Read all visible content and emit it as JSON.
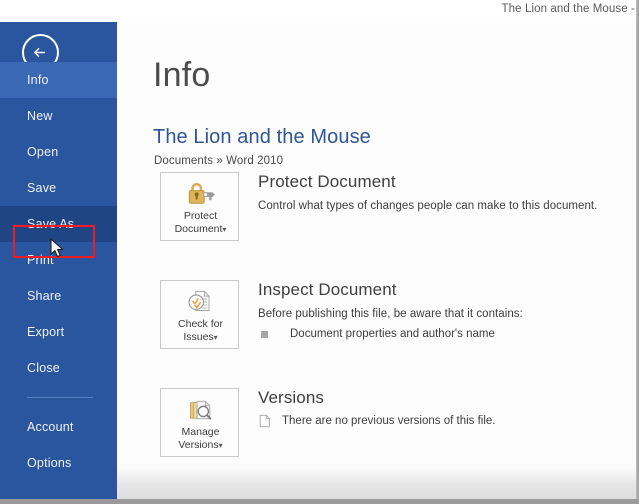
{
  "window": {
    "title": "The Lion and the Mouse -"
  },
  "sidebar": {
    "back_button": "back-arrow",
    "items": [
      {
        "label": "Info",
        "state": "active"
      },
      {
        "label": "New",
        "state": "normal"
      },
      {
        "label": "Open",
        "state": "normal"
      },
      {
        "label": "Save",
        "state": "normal"
      },
      {
        "label": "Save As",
        "state": "selected"
      },
      {
        "label": "Print",
        "state": "normal"
      },
      {
        "label": "Share",
        "state": "normal"
      },
      {
        "label": "Export",
        "state": "normal"
      },
      {
        "label": "Close",
        "state": "normal"
      }
    ],
    "items_bottom": [
      {
        "label": "Account",
        "state": "normal"
      },
      {
        "label": "Options",
        "state": "normal"
      }
    ],
    "highlight_color": "#ee1c24",
    "background_color": "#2a569f"
  },
  "main": {
    "page_title": "Info",
    "document_title": "The Lion and the Mouse",
    "document_path": "Documents » Word 2010",
    "sections": [
      {
        "tile_label_line1": "Protect",
        "tile_label_line2": "Document",
        "tile_caret": "▾",
        "tile_icon": "lock-key-icon",
        "heading": "Protect Document",
        "description": "Control what types of changes people can make to this document."
      },
      {
        "tile_label_line1": "Check for",
        "tile_label_line2": "Issues",
        "tile_caret": "▾",
        "tile_icon": "inspect-document-icon",
        "heading": "Inspect Document",
        "description": "Before publishing this file, be aware that it contains:",
        "bullet": "Document properties and author's name"
      },
      {
        "tile_label_line1": "Manage",
        "tile_label_line2": "Versions",
        "tile_caret": "▾",
        "tile_icon": "manage-versions-icon",
        "heading": "Versions",
        "version_note": "There are no previous versions of this file."
      }
    ]
  }
}
